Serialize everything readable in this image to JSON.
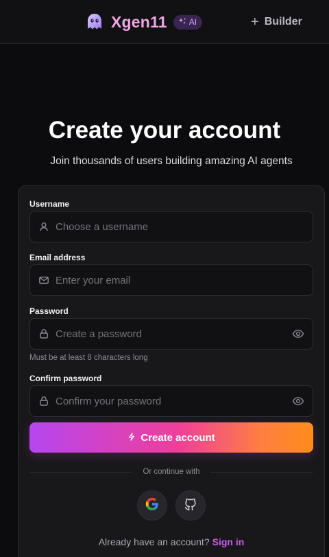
{
  "header": {
    "brand": "Xgen11",
    "badge": "AI",
    "builder_label": "Builder"
  },
  "hero": {
    "title": "Create your account",
    "subtitle": "Join thousands of users building amazing AI agents"
  },
  "form": {
    "username": {
      "label": "Username",
      "placeholder": "Choose a username",
      "value": ""
    },
    "email": {
      "label": "Email address",
      "placeholder": "Enter your email",
      "value": ""
    },
    "password": {
      "label": "Password",
      "placeholder": "Create a password",
      "value": "",
      "hint": "Must be at least 8 characters long"
    },
    "confirm": {
      "label": "Confirm password",
      "placeholder": "Confirm your password",
      "value": ""
    },
    "submit_label": "Create account",
    "divider_text": "Or continue with",
    "signin_prompt": "Already have an account?",
    "signin_link": "Sign in"
  },
  "social": [
    {
      "provider": "google",
      "icon": "google-icon"
    },
    {
      "provider": "github",
      "icon": "github-icon"
    }
  ],
  "colors": {
    "background": "#0c0c0e",
    "card": "#18181b",
    "brand_pink": "#f2a6e6",
    "badge_bg": "#3a2450",
    "gradient_start": "#b646f0",
    "gradient_mid": "#ee3f9b",
    "gradient_end": "#ff8c1a",
    "link": "#c95ce8"
  }
}
